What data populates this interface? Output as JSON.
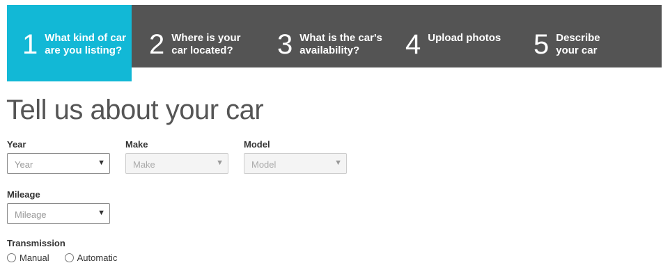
{
  "steps": [
    {
      "number": "1",
      "line1": "What kind of car",
      "line2": "are you listing?",
      "active": true
    },
    {
      "number": "2",
      "line1": "Where is your",
      "line2": "car located?",
      "active": false
    },
    {
      "number": "3",
      "line1": "What is the car's",
      "line2": "availability?",
      "active": false
    },
    {
      "number": "4",
      "line1": "Upload photos",
      "line2": "",
      "active": false
    },
    {
      "number": "5",
      "line1": "Describe",
      "line2": "your car",
      "active": false
    }
  ],
  "colors": {
    "steps_bar": "#545454",
    "active_step": "#12b8d6"
  },
  "form": {
    "title": "Tell us about your car",
    "year": {
      "label": "Year",
      "value": "Year"
    },
    "make": {
      "label": "Make",
      "value": "Make",
      "disabled": true
    },
    "model": {
      "label": "Model",
      "value": "Model",
      "disabled": true
    },
    "mileage": {
      "label": "Mileage",
      "value": "Mileage"
    },
    "transmission": {
      "label": "Transmission",
      "options": [
        "Manual",
        "Automatic"
      ]
    }
  },
  "icons": {
    "caret": "▼"
  }
}
